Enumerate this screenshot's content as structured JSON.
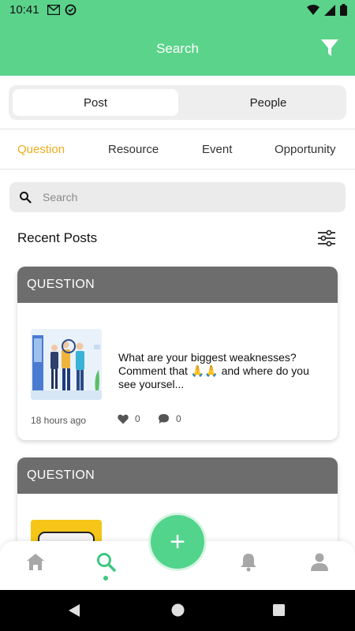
{
  "status_bar": {
    "time": "10:41"
  },
  "app_bar": {
    "title": "Search"
  },
  "segment": {
    "options": [
      "Post",
      "People"
    ],
    "selected": "Post"
  },
  "categories": {
    "items": [
      "Question",
      "Resource",
      "Event",
      "Opportunity"
    ],
    "active": "Question"
  },
  "search": {
    "placeholder": "Search",
    "value": ""
  },
  "recent": {
    "title": "Recent Posts"
  },
  "posts": [
    {
      "type_label": "QUESTION",
      "text": "What are your biggest weaknesses? Comment that 🙏🙏 and where do you see yoursel...",
      "time": "18 hours ago",
      "likes": "0",
      "comments": "0"
    },
    {
      "type_label": "QUESTION"
    }
  ],
  "colors": {
    "brand_green": "#5bd38b",
    "accent": "#f0ad1e",
    "card_header": "#6d6d6d"
  },
  "icons": {
    "app_bar": [
      "filter-icon"
    ],
    "nav": [
      "home-icon",
      "search-icon",
      "add-icon",
      "bell-icon",
      "profile-icon"
    ]
  }
}
